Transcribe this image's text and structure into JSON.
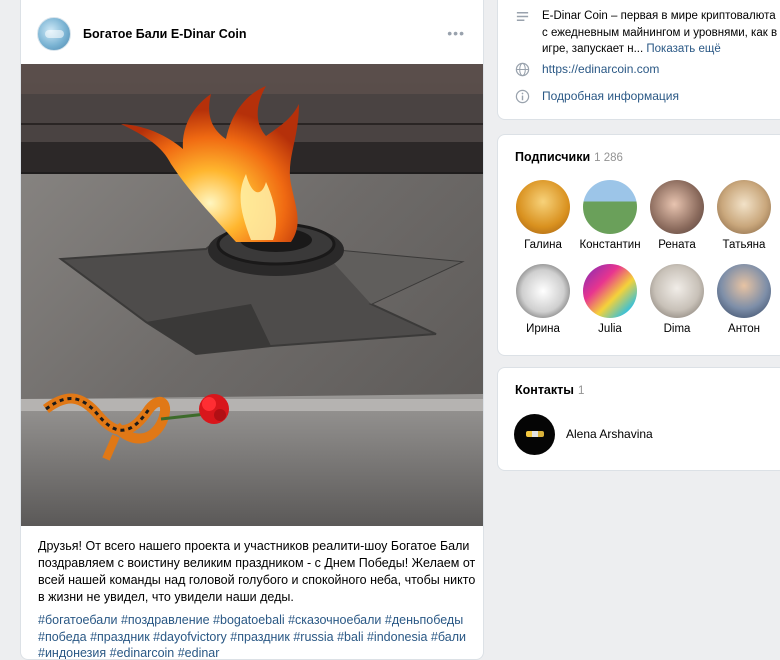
{
  "post": {
    "author": "Богатое Бали E-Dinar Coin",
    "text": "Друзья! От всего нашего проекта и участников реалити-шоу Богатое Бали поздравляем с воистину великим праздником - с Днем Победы! Желаем от всей нашей команды над головой голубого и спокойного неба, чтобы никто в жизни не увидел, что увидели наши деды.",
    "hashtags": "#богатоебали #поздравление #bogatoebali #сказочноебали #деньпобеды #победа #праздник #dayofvictory #праздник #russia #bali #indonesia #бали #индонезия #edinarcoin #edinar"
  },
  "info": {
    "description": "E-Dinar Coin – первая в мире криптовалюта с ежедневным майнингом и уровнями, как в игре, запускает н...",
    "show_more": "Показать ещё",
    "website": "https://edinarcoin.com",
    "details": "Подробная информация"
  },
  "subscribers": {
    "title": "Подписчики",
    "count": "1 286",
    "people": [
      {
        "name": "Галина"
      },
      {
        "name": "Константин"
      },
      {
        "name": "Рената"
      },
      {
        "name": "Татьяна"
      },
      {
        "name": "Ирина"
      },
      {
        "name": "Julia"
      },
      {
        "name": "Dima"
      },
      {
        "name": "Антон"
      }
    ]
  },
  "contacts": {
    "title": "Контакты",
    "count": "1",
    "items": [
      {
        "name": "Alena Arshavina"
      }
    ]
  }
}
